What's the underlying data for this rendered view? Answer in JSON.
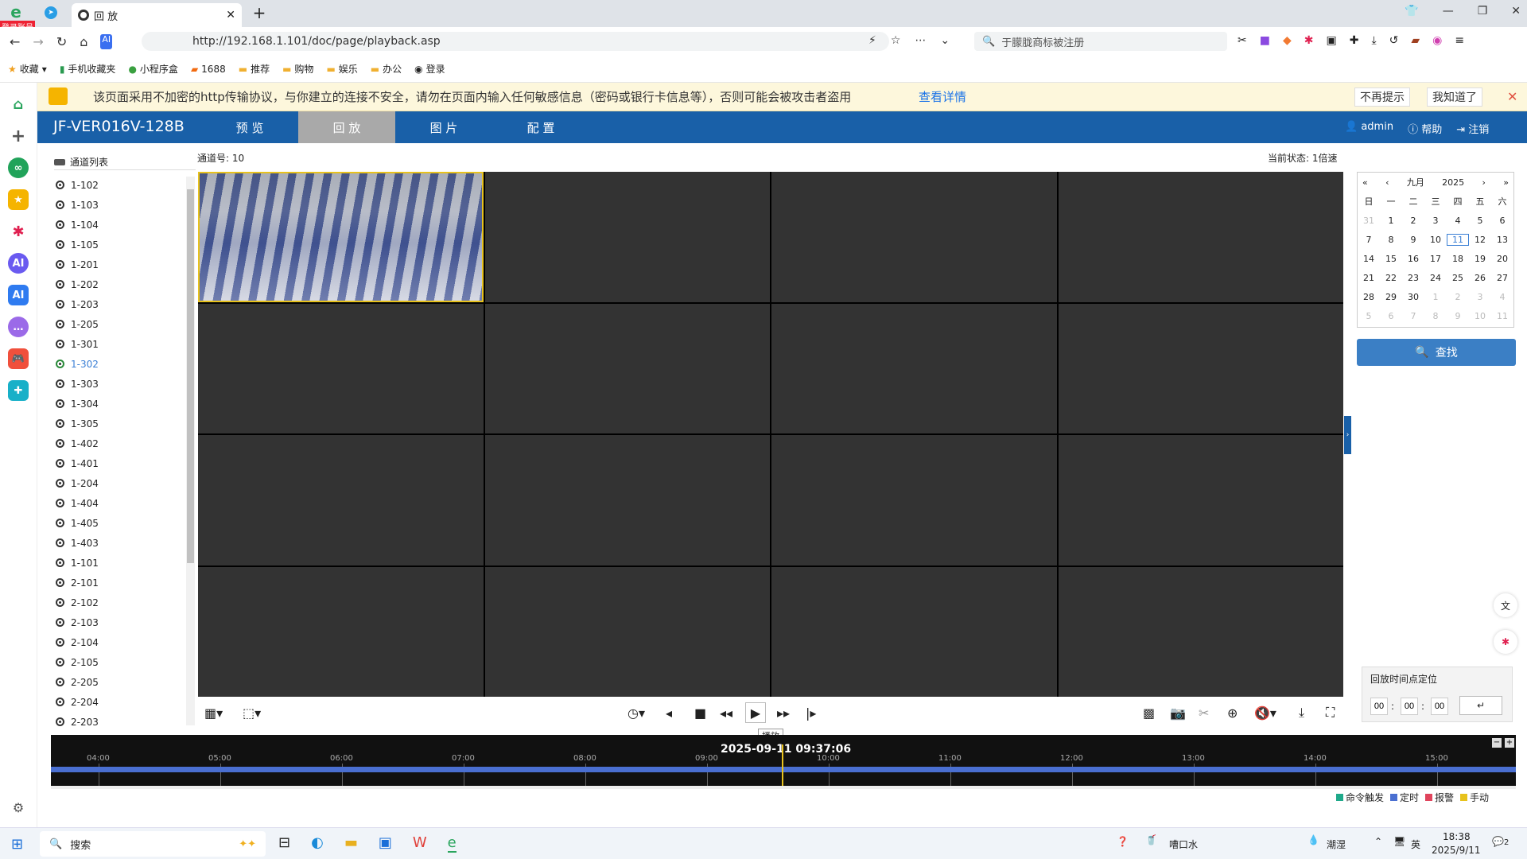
{
  "browser": {
    "tab_title": "回 放",
    "url": "http://192.168.1.101/doc/page/playback.asp",
    "search_placeholder": "于朦胧商标被注册",
    "login_badge": "登录账号"
  },
  "bookmarks": [
    "收藏",
    "手机收藏夹",
    "小程序盒",
    "1688",
    "推荐",
    "购物",
    "娱乐",
    "办公",
    "登录"
  ],
  "warning": {
    "text": "该页面采用不加密的http传输协议，与你建立的连接不安全，请勿在页面内输入任何敏感信息（密码或银行卡信息等），否则可能会被攻击者盗用",
    "link": "查看详情",
    "btn_nomore": "不再提示",
    "btn_ok": "我知道了"
  },
  "app": {
    "device": "JF-VER016V-128B",
    "nav": [
      "预 览",
      "回 放",
      "图 片",
      "配 置"
    ],
    "user": "admin",
    "help": "帮助",
    "logout": "注销"
  },
  "channel_panel": {
    "title": "通道列表",
    "channel_no": "通道号: 10",
    "status": "当前状态: 1倍速"
  },
  "channels": [
    "1-102",
    "1-103",
    "1-104",
    "1-105",
    "1-201",
    "1-202",
    "1-203",
    "1-205",
    "1-301",
    "1-302",
    "1-303",
    "1-304",
    "1-305",
    "1-402",
    "1-401",
    "1-204",
    "1-404",
    "1-405",
    "1-403",
    "1-101",
    "2-101",
    "2-102",
    "2-103",
    "2-104",
    "2-105",
    "2-205",
    "2-204",
    "2-203"
  ],
  "selected_channel": "1-302",
  "calendar": {
    "month": "九月",
    "year": "2025",
    "weekdays": [
      "日",
      "一",
      "二",
      "三",
      "四",
      "五",
      "六"
    ],
    "weeks": [
      [
        "31",
        "1",
        "2",
        "3",
        "4",
        "5",
        "6"
      ],
      [
        "7",
        "8",
        "9",
        "10",
        "11",
        "12",
        "13"
      ],
      [
        "14",
        "15",
        "16",
        "17",
        "18",
        "19",
        "20"
      ],
      [
        "21",
        "22",
        "23",
        "24",
        "25",
        "26",
        "27"
      ],
      [
        "28",
        "29",
        "30",
        "1",
        "2",
        "3",
        "4"
      ],
      [
        "5",
        "6",
        "7",
        "8",
        "9",
        "10",
        "11"
      ]
    ],
    "today": "11"
  },
  "find_label": "查找",
  "timepos": {
    "title": "回放时间点定位",
    "h": "00",
    "m": "00",
    "s": "00"
  },
  "tooltip": "播放",
  "timeline": {
    "current": "2025-09-11 09:37:06",
    "ticks": [
      "04:00",
      "05:00",
      "06:00",
      "07:00",
      "08:00",
      "09:00",
      "10:00",
      "11:00",
      "12:00",
      "13:00",
      "14:00",
      "15:00"
    ]
  },
  "legend": [
    {
      "label": "命令触发",
      "color": "#1fa98a"
    },
    {
      "label": "定时",
      "color": "#4a6fd1"
    },
    {
      "label": "报警",
      "color": "#e0445c"
    },
    {
      "label": "手动",
      "color": "#e7c21c"
    }
  ],
  "taskbar": {
    "search": "搜索",
    "weather": "嘈口水",
    "humid": "潮湿",
    "lang": "英",
    "time": "18:38",
    "date": "2025/9/11",
    "notif": "2"
  }
}
